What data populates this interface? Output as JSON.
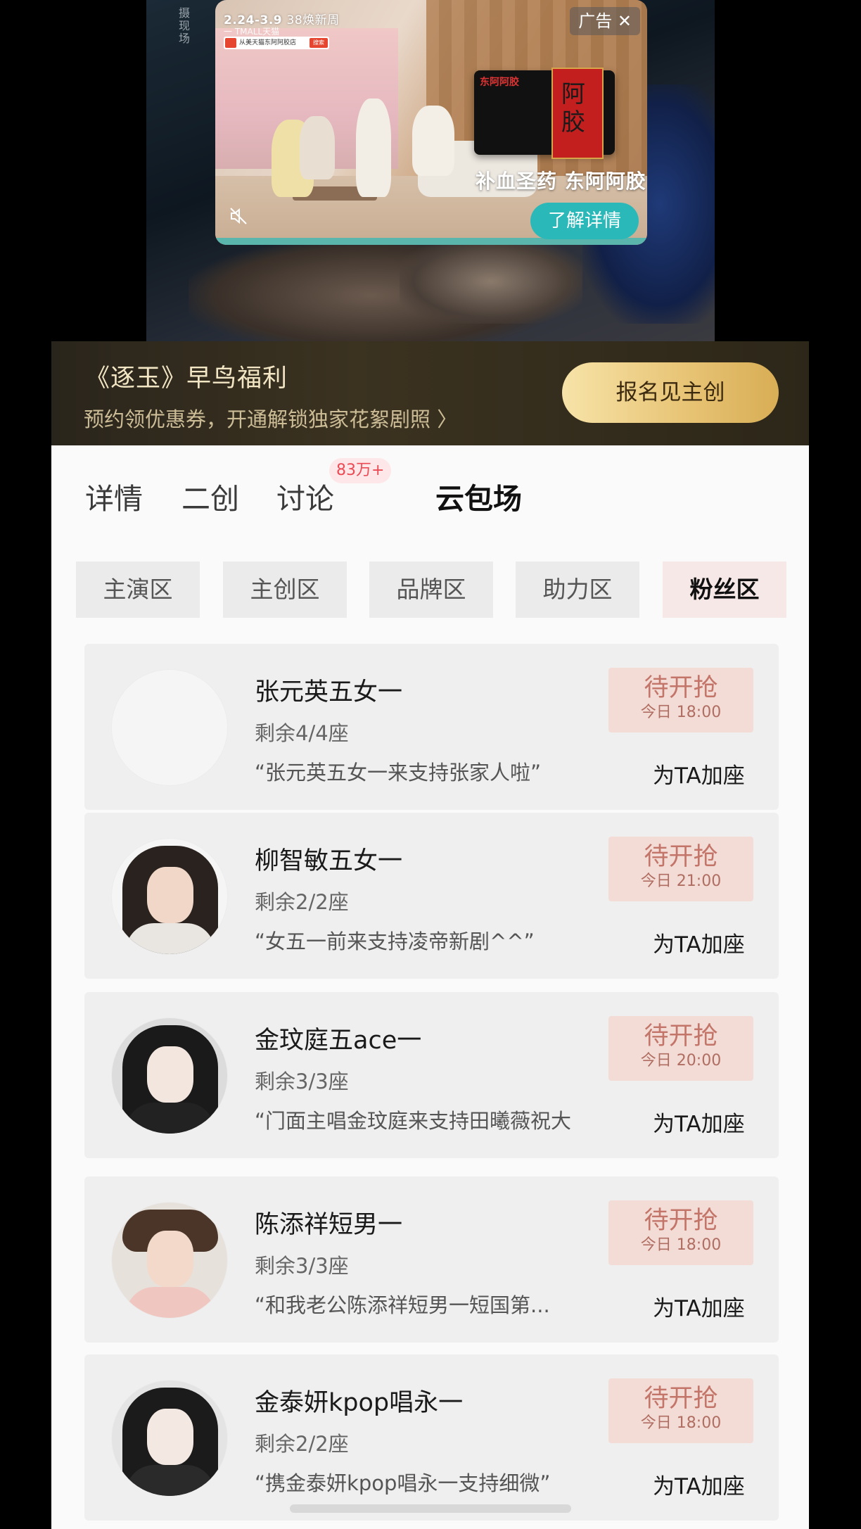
{
  "video": {
    "side_caption": "摄现场"
  },
  "ad": {
    "top_date": "2.24-3.9",
    "top_event": "38焕新周",
    "sub_line": "一 TMALL天猫",
    "search_text": "从美天猫东阿阿胶店",
    "search_btn": "搜索",
    "label": "广告 ✕",
    "product_brand": "东阿阿胶",
    "product_big": "阿胶",
    "slogan": "补血圣药 东阿阿胶",
    "cta": "了解详情",
    "mute_icon": "mute-icon"
  },
  "banner": {
    "title": "《逐玉》早鸟福利",
    "subtitle": "预约领优惠券，开通解锁独家花絮剧照 〉",
    "button": "报名见主创"
  },
  "tabs": {
    "items": [
      "详情",
      "二创",
      "讨论",
      "云包场"
    ],
    "badge": "83万+",
    "active_index": 3
  },
  "chips": {
    "items": [
      "主演区",
      "主创区",
      "品牌区",
      "助力区",
      "粉丝区"
    ],
    "active_index": 4
  },
  "cards": [
    {
      "name": "张元英五女一",
      "seats": "剩余4/4座",
      "quote": "“张元英五女一来支持张家人啦”",
      "status": "待开抢",
      "time": "今日 18:00",
      "action": "为TA加座",
      "avatar": "blank-avatar"
    },
    {
      "name": "柳智敏五女一",
      "seats": "剩余2/2座",
      "quote": "“女五一前来支持凌帝新剧^^”",
      "status": "待开抢",
      "time": "今日 21:00",
      "action": "为TA加座",
      "avatar": "user-avatar"
    },
    {
      "name": "金玟庭五ace一",
      "seats": "剩余3/3座",
      "quote": "“门面主唱金玟庭来支持田曦薇祝大",
      "status": "待开抢",
      "time": "今日 20:00",
      "action": "为TA加座",
      "avatar": "user-avatar"
    },
    {
      "name": "陈添祥短男一",
      "seats": "剩余3/3座",
      "quote": "“和我老公陈添祥短男一短国第...",
      "status": "待开抢",
      "time": "今日 18:00",
      "action": "为TA加座",
      "avatar": "user-avatar"
    },
    {
      "name": "金泰妍kpop唱永一",
      "seats": "剩余2/2座",
      "quote": "“携金泰妍kpop唱永一支持细微”",
      "status": "待开抢",
      "time": "今日 18:00",
      "action": "为TA加座",
      "avatar": "user-avatar"
    }
  ],
  "colors": {
    "banner_bg": "#2a251c",
    "banner_gold": "#e8c577",
    "grab_bg": "#f3dcd6",
    "grab_text": "#c27568",
    "badge_text": "#ea4b55",
    "ad_cta": "#2bb8b8"
  }
}
